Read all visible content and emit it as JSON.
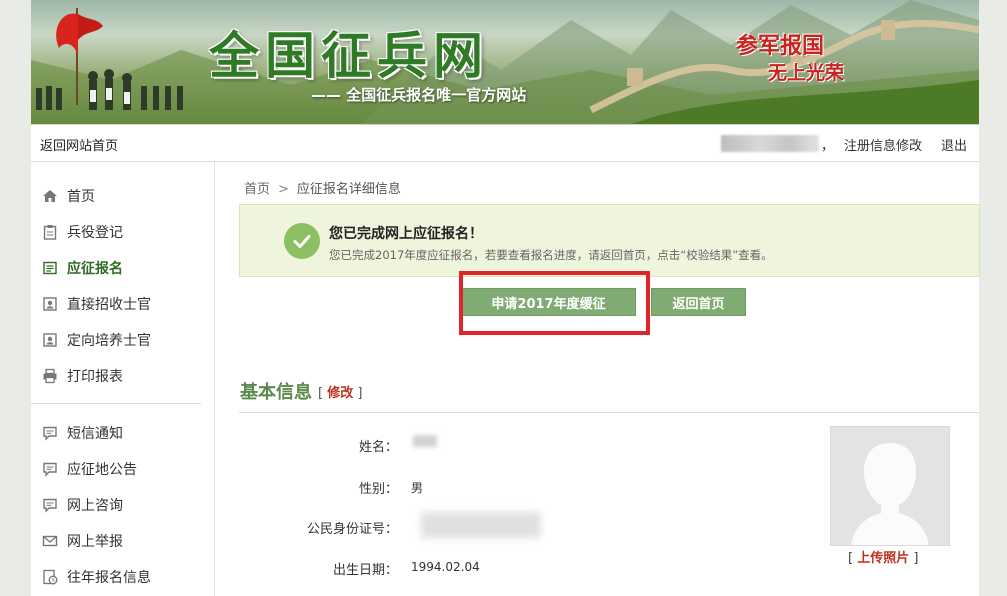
{
  "banner": {
    "title": "全国征兵网",
    "subtitle": "—— 全国征兵报名唯一官方网站",
    "slogan_line1": "参军报国",
    "slogan_line2": "无上光荣"
  },
  "topbar": {
    "home_link": "返回网站首页",
    "separator": "，",
    "edit_profile": "注册信息修改",
    "logout": "退出"
  },
  "sidebar": {
    "items": [
      {
        "label": "首页",
        "icon": "home-icon"
      },
      {
        "label": "兵役登记",
        "icon": "clipboard-icon"
      },
      {
        "label": "应征报名",
        "icon": "form-icon",
        "active": true
      },
      {
        "label": "直接招收士官",
        "icon": "id-card-icon"
      },
      {
        "label": "定向培养士官",
        "icon": "id-card-icon"
      },
      {
        "label": "打印报表",
        "icon": "printer-icon"
      },
      {
        "label": "短信通知",
        "icon": "message-icon"
      },
      {
        "label": "应征地公告",
        "icon": "message-icon"
      },
      {
        "label": "网上咨询",
        "icon": "message-icon"
      },
      {
        "label": "网上举报",
        "icon": "mail-icon"
      },
      {
        "label": "往年报名信息",
        "icon": "history-icon"
      }
    ]
  },
  "breadcrumb": {
    "home": "首页",
    "separator": ">",
    "current": "应征报名详细信息"
  },
  "notice": {
    "title": "您已完成网上应征报名！",
    "description": "您已完成2017年度应征报名，若要查看报名进度，请返回首页，点击“校验结果”查看。"
  },
  "actions": {
    "apply_deferral": "申请2017年度缓征",
    "back_home": "返回首页"
  },
  "basic_info": {
    "title": "基本信息",
    "edit_bracket_open": "[",
    "edit_label": "修改",
    "edit_bracket_close": "]",
    "fields": {
      "name_label": "姓名：",
      "gender_label": "性别：",
      "gender_value": "男",
      "id_label": "公民身份证号：",
      "birth_label": "出生日期：",
      "birth_value": "1994.02.04"
    },
    "upload_bracket_open": "[",
    "upload_label": "上传照片",
    "upload_bracket_close": "]"
  },
  "colors": {
    "accent_green": "#80ac73",
    "title_green": "#5c8a4d",
    "highlight_red": "#e0252a",
    "link_red": "#c0311f"
  }
}
